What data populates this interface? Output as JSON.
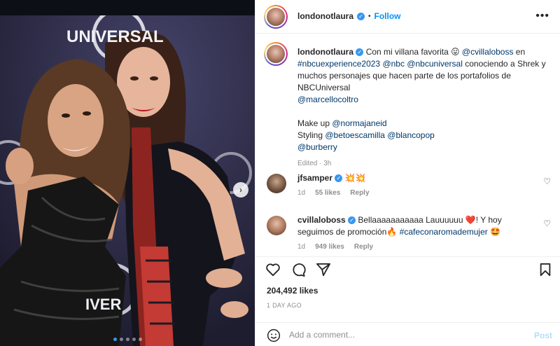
{
  "post": {
    "username": "londonotlaura",
    "follow_label": "Follow",
    "more_label": "•••",
    "separator": "•"
  },
  "media": {
    "sign_top": "UNIVERSAL",
    "sign_bottom": "IVER",
    "next_arrow": "›",
    "carousel_count": 5,
    "carousel_active": 0
  },
  "caption": {
    "intro": "Con mi villana favorita 😛 ",
    "m1": "@cvillaloboss",
    "t1": " en ",
    "m2": "#nbcuexperience2023",
    "t2": " ",
    "m3": "@nbc",
    "t3": " ",
    "m4": "@nbcuniversal",
    "t4": " conociendo a Shrek y muchos personajes que hacen parte de los portafolios de NBCUniversal",
    "m5": "@marcellocoltro",
    "makeup_label": "Make up ",
    "m6": "@normajaneid",
    "styling_label": "Styling ",
    "m7": "@betoescamilla",
    "t5": " ",
    "m8": "@blancopop",
    "m9": "@burberry",
    "edited": "Edited · 3h"
  },
  "comments": [
    {
      "username": "jfsamper",
      "text": " 💥💥",
      "time": "1d",
      "likes": "55 likes",
      "reply": "Reply"
    },
    {
      "username": "cvillaloboss",
      "text_a": " Bellaaaaaaaaaaa Lauuuuuu ❤️! Y hoy seguimos de promoción🔥 ",
      "hashtag": "#cafeconaromademujer",
      "text_b": " 🤩",
      "time": "1d",
      "likes": "949 likes",
      "reply": "Reply"
    }
  ],
  "likes_count": "204,492 likes",
  "posted_time": "1 DAY AGO",
  "composer": {
    "placeholder": "Add a comment...",
    "post_label": "Post"
  },
  "icons": [
    "heart-icon",
    "comment-icon",
    "share-icon",
    "bookmark-icon",
    "emoji-icon",
    "verified-badge-icon",
    "more-icon",
    "chevron-right-icon"
  ],
  "colors": {
    "link": "#00376b",
    "follow": "#0095f6",
    "verified": "#3897f0",
    "meta": "#8e8e8e",
    "post_disabled": "#b2dffc"
  }
}
